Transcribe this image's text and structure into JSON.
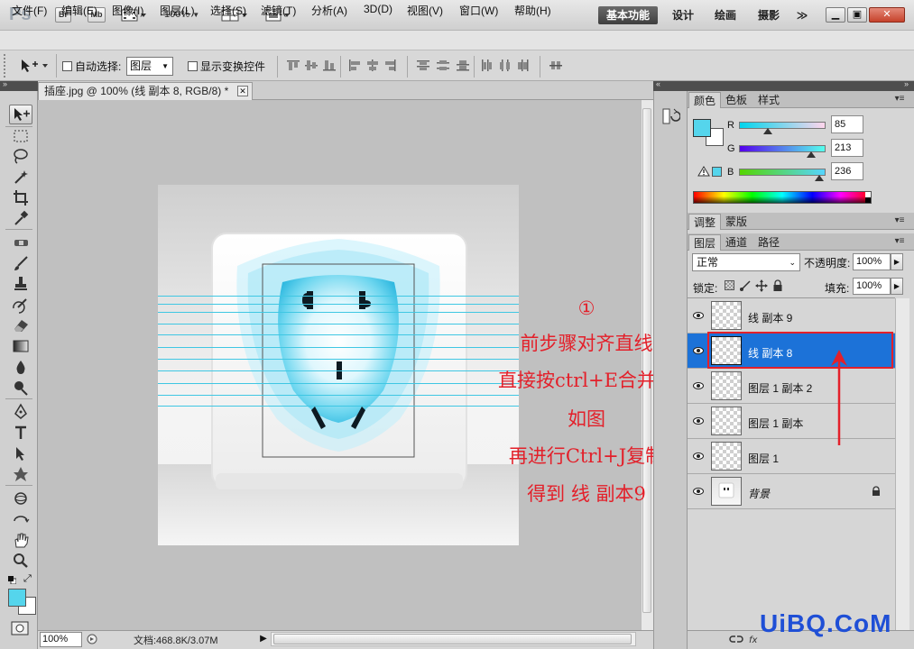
{
  "app": {
    "logo": "Ps",
    "bridge_label": "Br",
    "minibridge_label": "Mb",
    "zoom_level": "100%"
  },
  "workspaces": {
    "basic": "基本功能",
    "design": "设计",
    "painting": "绘画",
    "photography": "摄影",
    "more": "≫"
  },
  "menu": [
    "文件(F)",
    "编辑(E)",
    "图像(I)",
    "图层(L)",
    "选择(S)",
    "滤镜(T)",
    "分析(A)",
    "3D(D)",
    "视图(V)",
    "窗口(W)",
    "帮助(H)"
  ],
  "options": {
    "auto_select_label": "自动选择:",
    "auto_select_target": "图层",
    "show_transform_label": "显示变换控件"
  },
  "document": {
    "tab_title": "插座.jpg @ 100% (线 副本 8, RGB/8) *",
    "zoom_field": "100%",
    "doc_info": "文档:468.8K/3.07M"
  },
  "annotation": {
    "step_marker": "①",
    "lines": [
      "前步骤对齐直线",
      "直接按ctrl+E合并层",
      "如图",
      "再进行Ctrl+J复制",
      "得到 线 副本9"
    ]
  },
  "color_panel": {
    "tabs": [
      "颜色",
      "色板",
      "样式"
    ],
    "channels": [
      {
        "label": "R",
        "value": "85",
        "fraction": 0.333
      },
      {
        "label": "G",
        "value": "213",
        "fraction": 0.835
      },
      {
        "label": "B",
        "value": "236",
        "fraction": 0.925
      }
    ],
    "foreground_color": "#55d5ec"
  },
  "adjust_panel": {
    "tabs": [
      "调整",
      "蒙版"
    ]
  },
  "layers_panel": {
    "tabs": [
      "图层",
      "通道",
      "路径"
    ],
    "blend_mode": "正常",
    "opacity_label": "不透明度:",
    "opacity_value": "100%",
    "lock_label": "锁定:",
    "fill_label": "填充:",
    "fill_value": "100%",
    "layers": [
      {
        "name": "线 副本 9",
        "selected": false,
        "visible": true
      },
      {
        "name": "线 副本 8",
        "selected": true,
        "visible": true
      },
      {
        "name": "图层 1 副本 2",
        "selected": false,
        "visible": true
      },
      {
        "name": "图层 1 副本",
        "selected": false,
        "visible": true
      },
      {
        "name": "图层 1",
        "selected": false,
        "visible": true
      },
      {
        "name": "背景",
        "selected": false,
        "visible": true,
        "locked": true
      }
    ]
  },
  "watermark": "UiBQ.CoM",
  "colors": {
    "accent_selected": "#1c72d8",
    "annotation_red": "#e3202a",
    "guide_cyan": "#3fc7e3"
  }
}
